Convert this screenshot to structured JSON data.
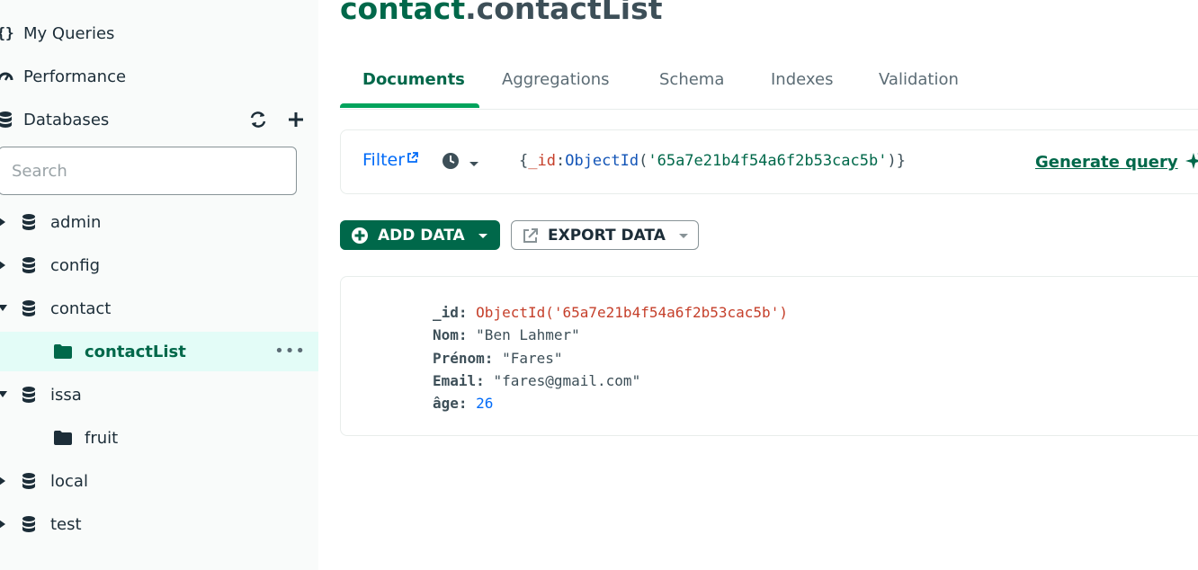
{
  "sidebar": {
    "nav": [
      {
        "label": "My Queries",
        "icon": "braces-icon"
      },
      {
        "label": "Performance",
        "icon": "gauge-icon"
      },
      {
        "label": "Databases",
        "icon": "database-icon"
      }
    ],
    "search_placeholder": "Search",
    "databases": [
      {
        "name": "admin",
        "expanded": false
      },
      {
        "name": "config",
        "expanded": false
      },
      {
        "name": "contact",
        "expanded": true,
        "collections": [
          "contactList"
        ]
      },
      {
        "name": "issa",
        "expanded": true,
        "collections": [
          "fruit"
        ]
      },
      {
        "name": "local",
        "expanded": false
      },
      {
        "name": "test",
        "expanded": false
      }
    ],
    "selected_collection": "contactList"
  },
  "header": {
    "db": "contact",
    "dot": ".",
    "collection": "contactList"
  },
  "tabs": [
    "Documents",
    "Aggregations",
    "Schema",
    "Indexes",
    "Validation"
  ],
  "active_tab": "Documents",
  "filter": {
    "label": "Filter",
    "query": {
      "open": "{",
      "key": "_id",
      "colon": ":",
      "fn": "ObjectId",
      "paren_open": "(",
      "value": "'65a7e21b4f54a6f2b53cac5b'",
      "paren_close": ")",
      "close": "}"
    },
    "generate_label": "Generate query"
  },
  "actions": {
    "add_label": "ADD DATA",
    "export_label": "EXPORT DATA"
  },
  "document": {
    "fields": [
      {
        "key": "_id",
        "value": "ObjectId('65a7e21b4f54a6f2b53cac5b')",
        "type": "oid"
      },
      {
        "key": "Nom",
        "value": "\"Ben Lahmer\"",
        "type": "str"
      },
      {
        "key": "Prénom",
        "value": "\"Fares\"",
        "type": "str"
      },
      {
        "key": "Email",
        "value": "\"fares@gmail.com\"",
        "type": "str"
      },
      {
        "key": "âge",
        "value": "26",
        "type": "num"
      }
    ]
  },
  "colors": {
    "brand": "#00684a",
    "accent": "#00a35c",
    "link": "#016bf8",
    "oid": "#c53f2a",
    "sidebar_bg": "#f9fbfa",
    "selected_bg": "#e3fcf7"
  }
}
